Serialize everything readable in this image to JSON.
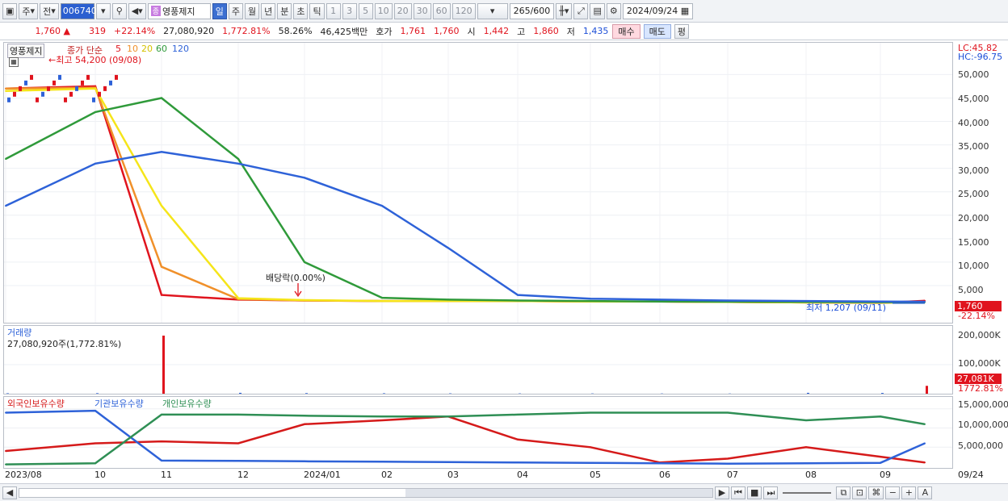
{
  "toolbar": {
    "period_type": "주",
    "prev_label": "전",
    "stock_code": "006740",
    "stock_badge": "종",
    "stock_name": "영풍제지",
    "period_buttons": [
      "일",
      "주",
      "월",
      "년",
      "분",
      "초",
      "틱"
    ],
    "interval_buttons": [
      "1",
      "3",
      "5",
      "10",
      "20",
      "30",
      "60",
      "120"
    ],
    "page_count": "265",
    "page_total": "/600",
    "date": "2024/09/24"
  },
  "quote": {
    "price": "1,760 ▲",
    "change": "319",
    "change_pct": "+22.14%",
    "volume": "27,080,920",
    "volume_pct": "1,772.81%",
    "ratio": "58.26%",
    "amount": "46,425백만",
    "bid_label": "호가",
    "bid": "1,761",
    "ask": "1,760",
    "open_label": "시",
    "open": "1,442",
    "high_label": "고",
    "high": "1,860",
    "low_label": "저",
    "low": "1,435",
    "buy_label": "매수",
    "sell_label": "매도",
    "eval_label": "평"
  },
  "price_pane": {
    "legend_name": "영풍제지",
    "legend_ma": "종가 단순",
    "ma_periods": [
      "5",
      "10",
      "20",
      "60",
      "120"
    ],
    "high_marker": "최고 54,200 (09/08)",
    "low_marker": "최저 1,207 (09/11)",
    "dividend_marker": "배당락(0.00%)",
    "lc": "LC:45.82",
    "hc": "HC:-96.75",
    "current_price_tag": "1,760",
    "current_pct": "-22.14%",
    "y_ticks": [
      "50,000",
      "45,000",
      "40,000",
      "35,000",
      "30,000",
      "25,000",
      "20,000",
      "15,000",
      "10,000",
      "5,000"
    ]
  },
  "volume_pane": {
    "title": "거래량",
    "value_label": "27,080,920주(1,772.81%)",
    "y_ticks": [
      "200,000K",
      "100,000K"
    ],
    "current_tag": "27,081K",
    "current_pct": "1772.81%"
  },
  "holding_pane": {
    "legend": [
      "외국인보유수량",
      "기관보유수량",
      "개인보유수량"
    ],
    "y_ticks": [
      "15,000,000",
      "10,000,000",
      "5,000,000"
    ]
  },
  "x_axis": [
    "2023/08",
    "10",
    "11",
    "12",
    "2024/01",
    "02",
    "03",
    "04",
    "05",
    "06",
    "07",
    "08",
    "09",
    "09/24"
  ],
  "colors": {
    "ma5": "#e0141e",
    "ma10": "#f0902a",
    "ma20": "#f5e51a",
    "ma60": "#2f9a3a",
    "ma120": "#2e62d8",
    "foreign": "#d51a1a",
    "institution": "#2e62d8",
    "individual": "#2f8f55"
  },
  "chart_data": [
    {
      "type": "line",
      "title": "영풍제지 종가 단순 이동평균",
      "x": [
        "2023/08",
        "10",
        "11",
        "12",
        "2024/01",
        "02",
        "03",
        "04",
        "05",
        "06",
        "07",
        "08",
        "09",
        "09/24"
      ],
      "series": [
        {
          "name": "5",
          "values": [
            47000,
            47500,
            3000,
            2000,
            1800,
            1700,
            1700,
            1700,
            1600,
            1600,
            1500,
            1400,
            1300,
            1760
          ]
        },
        {
          "name": "10",
          "values": [
            47000,
            47200,
            9000,
            2100,
            1800,
            1700,
            1700,
            1700,
            1600,
            1600,
            1500,
            1400,
            1350,
            1500
          ]
        },
        {
          "name": "20",
          "values": [
            46500,
            47000,
            22000,
            2300,
            1900,
            1700,
            1700,
            1700,
            1600,
            1600,
            1500,
            1400,
            1400,
            1450
          ]
        },
        {
          "name": "60",
          "values": [
            32000,
            42000,
            45000,
            32000,
            10000,
            2400,
            2000,
            1800,
            1700,
            1600,
            1550,
            1500,
            1450,
            1450
          ]
        },
        {
          "name": "120",
          "values": [
            22000,
            31000,
            33500,
            31000,
            28000,
            22000,
            13000,
            3000,
            2200,
            2000,
            1800,
            1700,
            1600,
            1550
          ]
        }
      ],
      "ylim": [
        0,
        54200
      ]
    },
    {
      "type": "bar",
      "title": "거래량",
      "categories": [
        "2023/08",
        "10",
        "11",
        "12",
        "2024/01",
        "02",
        "03",
        "04",
        "05",
        "06",
        "07",
        "08",
        "09",
        "09/24"
      ],
      "values": [
        1500,
        1800,
        200000,
        3000,
        2000,
        1500,
        1200,
        1000,
        900,
        800,
        700,
        3000,
        2500,
        27081
      ],
      "ylabel": "K"
    },
    {
      "type": "line",
      "title": "보유수량",
      "x": [
        "2023/08",
        "10",
        "11",
        "12",
        "2024/01",
        "02",
        "03",
        "04",
        "05",
        "06",
        "07",
        "08",
        "09",
        "09/24"
      ],
      "series": [
        {
          "name": "외국인보유수량",
          "values": [
            4000000,
            6000000,
            6500000,
            6000000,
            11000000,
            12000000,
            13000000,
            7000000,
            5000000,
            1000000,
            2000000,
            5000000,
            2500000,
            1000000
          ]
        },
        {
          "name": "기관보유수량",
          "values": [
            14000000,
            14500000,
            1500000,
            1400000,
            1300000,
            1200000,
            1100000,
            1000000,
            900000,
            800000,
            700000,
            800000,
            900000,
            6000000
          ]
        },
        {
          "name": "개인보유수량",
          "values": [
            500000,
            800000,
            13500000,
            13500000,
            13200000,
            13000000,
            13000000,
            13500000,
            14000000,
            14000000,
            14000000,
            12000000,
            13000000,
            11000000
          ]
        }
      ]
    }
  ]
}
